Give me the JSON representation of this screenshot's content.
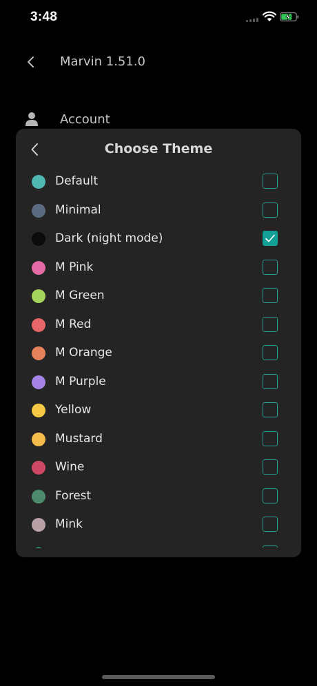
{
  "status_bar": {
    "time": "3:48"
  },
  "background": {
    "title": "Marvin 1.51.0",
    "account_label": "Account"
  },
  "modal": {
    "title": "Choose Theme",
    "check_color": "#139f96",
    "themes": [
      {
        "name": "Default",
        "color": "#4fb8b0",
        "checked": false
      },
      {
        "name": "Minimal",
        "color": "#5c6a80",
        "checked": false
      },
      {
        "name": "Dark (night mode)",
        "color": "#0b0b0b",
        "checked": true
      },
      {
        "name": "M Pink",
        "color": "#e46aa6",
        "checked": false
      },
      {
        "name": "M Green",
        "color": "#a6d35c",
        "checked": false
      },
      {
        "name": "M Red",
        "color": "#e46666",
        "checked": false
      },
      {
        "name": "M Orange",
        "color": "#e5825c",
        "checked": false
      },
      {
        "name": "M Purple",
        "color": "#a584e6",
        "checked": false
      },
      {
        "name": "Yellow",
        "color": "#f6c944",
        "checked": false
      },
      {
        "name": "Mustard",
        "color": "#f4bb4c",
        "checked": false
      },
      {
        "name": "Wine",
        "color": "#cc4863",
        "checked": false
      },
      {
        "name": "Forest",
        "color": "#4d8a6b",
        "checked": false
      },
      {
        "name": "Mink",
        "color": "#b9a0a6",
        "checked": false
      },
      {
        "name": "",
        "color": "#2dc99a",
        "checked": false
      }
    ]
  }
}
